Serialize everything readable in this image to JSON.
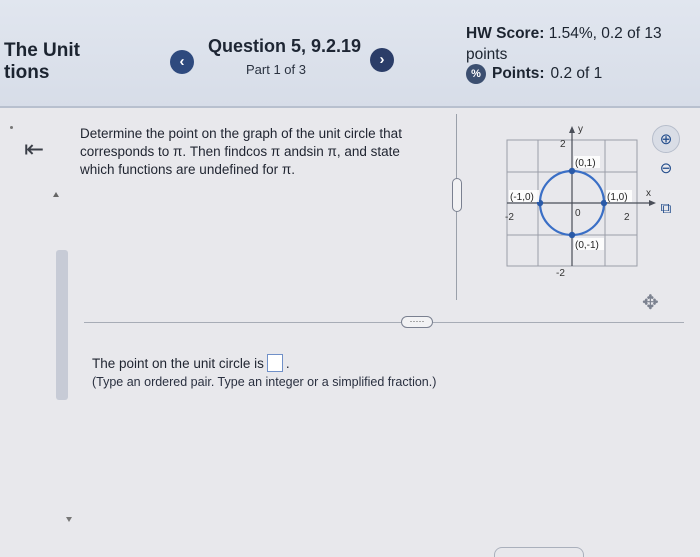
{
  "header": {
    "course_title_line1": "The Unit",
    "course_title_line2": "tions",
    "prev_icon": "chevron-left-icon",
    "prev_glyph": "‹",
    "next_icon": "chevron-right-icon",
    "next_glyph": "›",
    "question_title": "Question 5, 9.2.19",
    "part": "Part 1 of 3",
    "hw_score_label": "HW Score:",
    "hw_score_value": "1.54%, 0.2 of 13",
    "hw_score_unit": "points",
    "points_label": "Points:",
    "points_value": "0.2 of 1",
    "points_glyph": "%"
  },
  "main": {
    "back_glyph": "⇤",
    "question_text": "Determine the point on the graph of the unit circle that corresponds to π. Then findcos π andsin π, and state which functions are undefined for π.",
    "more_glyph": "·····",
    "answer_prefix": "The point on the unit circle is",
    "answer_value": "",
    "answer_suffix": ".",
    "hint": "(Type an ordered pair. Type an integer or a simplified fraction.)"
  },
  "graph": {
    "y_axis_label": "y",
    "x_axis_label": "x",
    "top_tick": "2",
    "bottom_tick": "-2",
    "left_tick": "-2",
    "right_tick": "2",
    "origin_label": "0",
    "point_top": "(0,1)",
    "point_left": "(-1,0)",
    "point_right": "(1,0)",
    "point_bottom": "(0,-1)",
    "circle_color": "#3a6fc6"
  },
  "tools": {
    "zoom_in_icon": "zoom-in-icon",
    "zoom_out_icon": "zoom-out-icon",
    "popout_icon": "external-link-icon",
    "move_icon": "move-icon",
    "zoom_in_glyph": "⊕",
    "zoom_out_glyph": "⊖",
    "popout_glyph": "⧉",
    "move_glyph": "✥"
  }
}
